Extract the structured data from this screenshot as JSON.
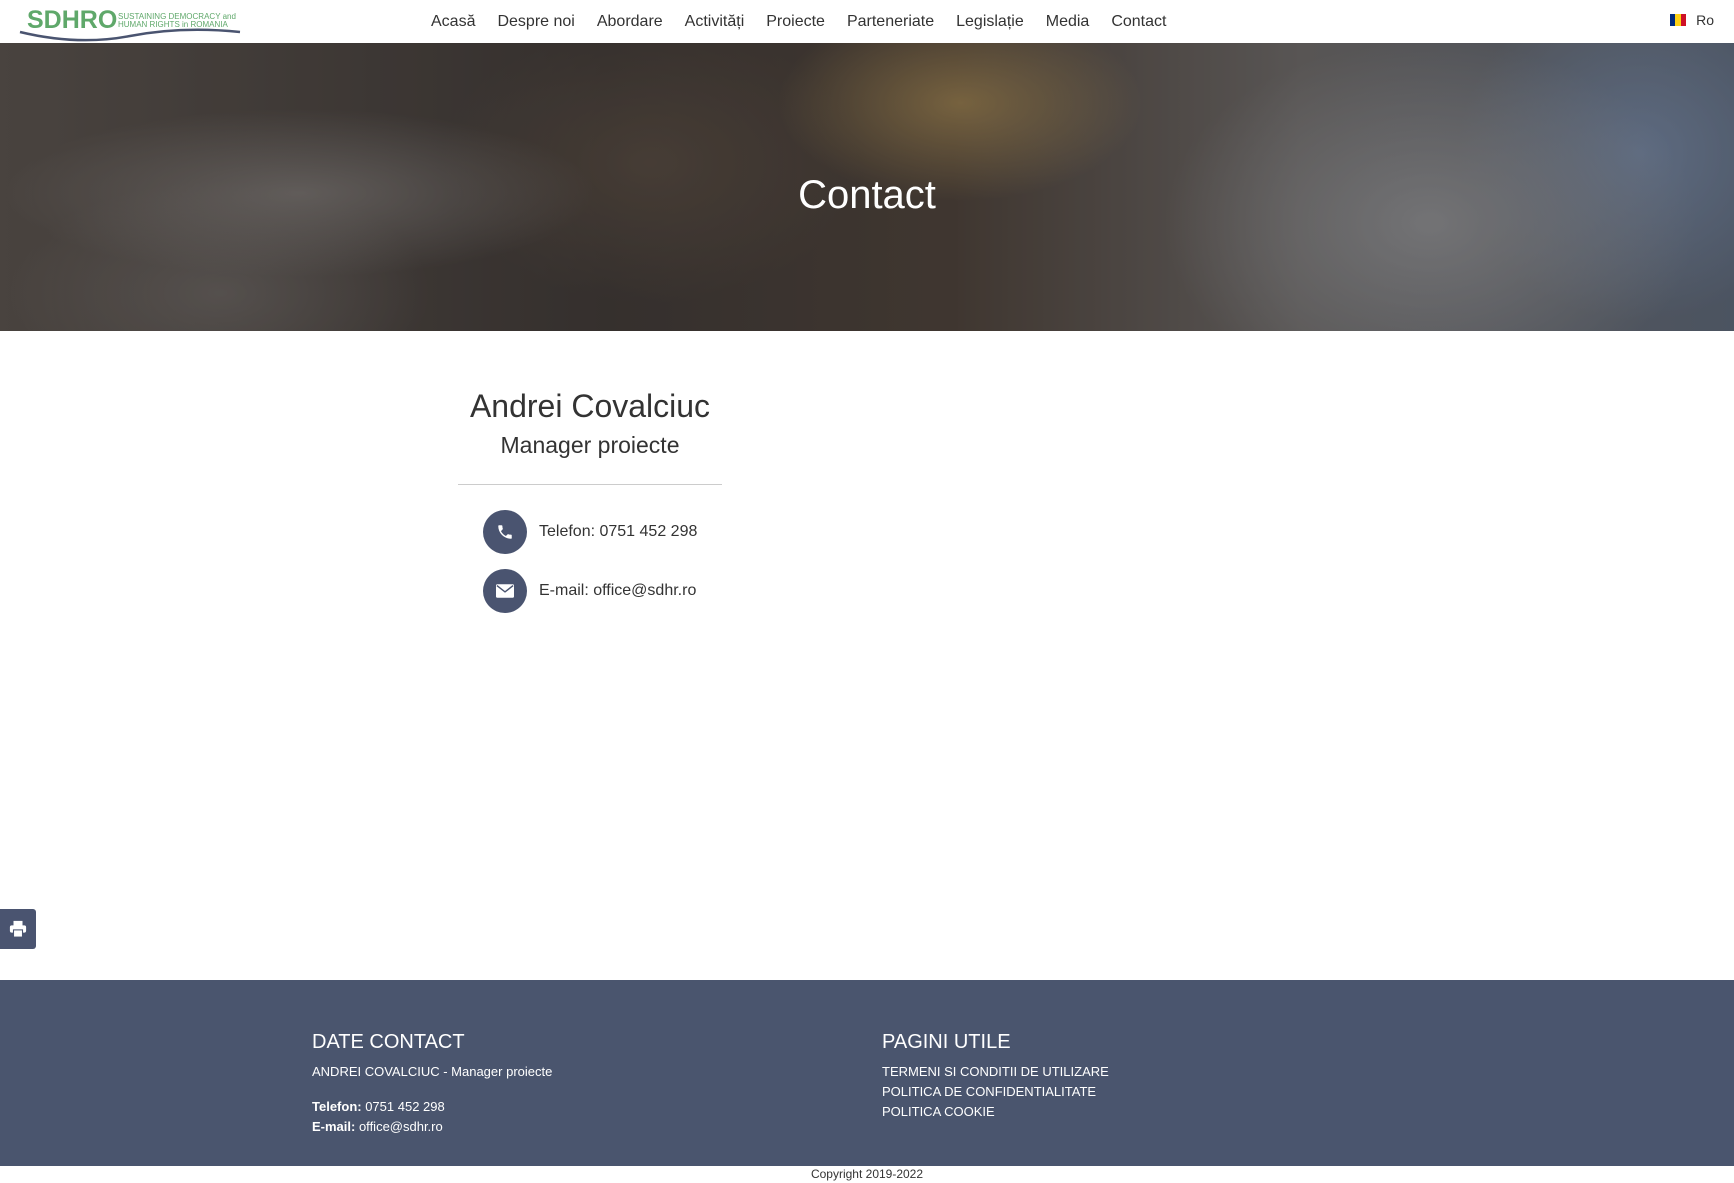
{
  "header": {
    "logo_text": "SDHRO",
    "logo_tagline_1": "SUSTAINING DEMOCRACY and",
    "logo_tagline_2": "HUMAN RIGHTS in ROMANIA",
    "nav": [
      "Acasă",
      "Despre noi",
      "Abordare",
      "Activități",
      "Proiecte",
      "Parteneriate",
      "Legislație",
      "Media",
      "Contact"
    ],
    "language": "Ro",
    "flag_colors": [
      "#002B7F",
      "#FCD116",
      "#CE1126"
    ]
  },
  "hero": {
    "title": "Contact"
  },
  "card": {
    "name": "Andrei Covalciuc",
    "role": "Manager proiecte",
    "phone": "Telefon: 0751 452 298",
    "email": "E-mail: office@sdhr.ro",
    "phone_icon": "phone-icon",
    "email_icon": "envelope-icon"
  },
  "print_button_icon": "print-icon",
  "footer": {
    "contact_heading": "DATE CONTACT",
    "contact_person": "ANDREI COVALCIUC - Manager proiecte",
    "phone_label": "Telefon:",
    "phone_value": " 0751 452 298",
    "email_label": "E-mail:",
    "email_value": " office@sdhr.ro",
    "links_heading": "PAGINI UTILE",
    "links": [
      "TERMENI SI CONDITII DE UTILIZARE",
      "POLITICA DE CONFIDENTIALITATE",
      "POLITICA COOKIE"
    ]
  },
  "copyright": "Copyright 2019-2022",
  "colors": {
    "accent": "#4a5470",
    "footer_bg": "#4a556e",
    "logo_green": "#5fa86a",
    "logo_swoosh": "#4a5470"
  }
}
